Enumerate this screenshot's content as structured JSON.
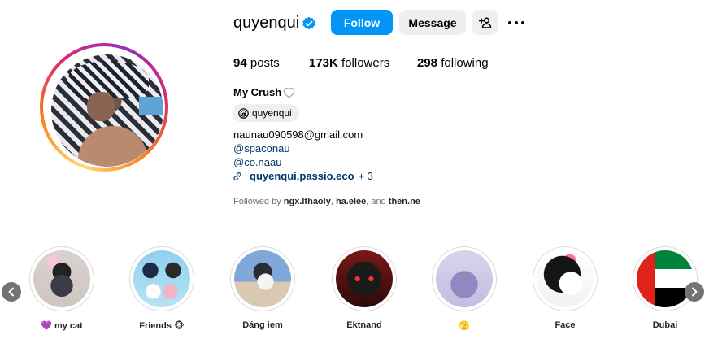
{
  "profile": {
    "username": "quyenqui",
    "follow_label": "Follow",
    "message_label": "Message",
    "icons": {
      "verified": "verified-badge-icon",
      "add_user": "add-user-icon",
      "more": "more-options-icon",
      "threads": "threads-icon",
      "link": "link-icon",
      "heart": "heart-outline-icon"
    },
    "colors": {
      "follow": "#0095f6",
      "verified": "#0095f6",
      "link": "#00376b",
      "secondary_button": "#efefef"
    }
  },
  "stats": {
    "posts_count": "94",
    "posts_label": "posts",
    "followers_count": "173K",
    "followers_label": "followers",
    "following_count": "298",
    "following_label": "following"
  },
  "bio": {
    "name": "My Crush",
    "threads_handle": "quyenqui",
    "email": "naunau090598@gmail.com",
    "mention_1": "@spaconau",
    "mention_2": "@co.naau",
    "link_text": "quyenqui.passio.eco",
    "link_more": "+ 3"
  },
  "followed_by": {
    "prefix": "Followed by",
    "user_1": "ngx.lthaoly",
    "sep_1": ",",
    "user_2": "ha.elee",
    "sep_2": ", and",
    "user_3": "then.ne"
  },
  "highlights": [
    {
      "label": "💜 my cat"
    },
    {
      "label": "Friends 🐵"
    },
    {
      "label": "Dáng iem"
    },
    {
      "label": "Ektnand"
    },
    {
      "label": "🫣"
    },
    {
      "label": "Face"
    },
    {
      "label": "Dubai"
    }
  ],
  "nav": {
    "prev_icon": "chevron-left-icon",
    "next_icon": "chevron-right-icon"
  }
}
